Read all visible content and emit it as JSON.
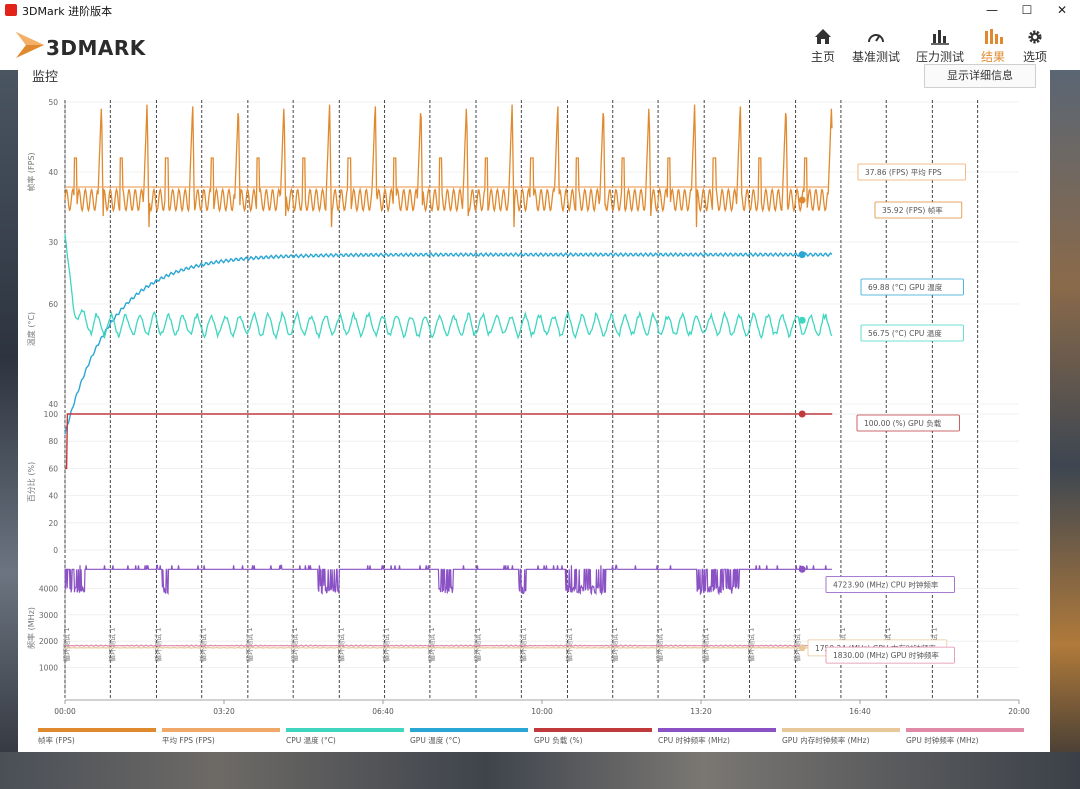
{
  "window": {
    "title": "3DMark 进阶版本",
    "minimize": "—",
    "maximize": "☐",
    "close": "✕"
  },
  "header": {
    "logo_text": "3DMARK",
    "nav": [
      {
        "label": "主页",
        "icon": "home-icon"
      },
      {
        "label": "基准测试",
        "icon": "gauge-icon"
      },
      {
        "label": "压力测试",
        "icon": "stress-chart-icon"
      },
      {
        "label": "结果",
        "icon": "results-bars-icon",
        "active": true
      },
      {
        "label": "选项",
        "icon": "gear-icon"
      }
    ]
  },
  "panel": {
    "title": "监控",
    "detail_button": "显示详细信息"
  },
  "colors": {
    "fps": "#e08a30",
    "avg_fps": "#f0a868",
    "cpu_temp": "#3fd6c0",
    "gpu_temp": "#2aa6d4",
    "gpu_load": "#c0393b",
    "cpu_clock": "#8a52c4",
    "gpu_mem_clock": "#e8c89a",
    "gpu_clock": "#e08aa8"
  },
  "chart_data": [
    {
      "type": "line",
      "ylabel": "帧率 (FPS)",
      "ylim": [
        30,
        50
      ],
      "yticks": [
        30,
        40,
        50
      ],
      "series": [
        {
          "name": "帧率 (FPS)",
          "pattern": "spiky",
          "base": 36,
          "spike": 50
        },
        {
          "name": "平均 FPS",
          "value": 37.86
        }
      ],
      "callouts": [
        {
          "text": "37.86 (FPS) 平均 FPS"
        },
        {
          "text": "35.92 (FPS) 帧率"
        }
      ]
    },
    {
      "type": "line",
      "ylabel": "温度 (°C)",
      "ylim": [
        40,
        70
      ],
      "yticks": [
        40,
        60
      ],
      "series": [
        {
          "name": "GPU 温度",
          "start": 34,
          "end": 69.88
        },
        {
          "name": "CPU 温度",
          "start": 75,
          "end": 56.75
        }
      ],
      "callouts": [
        {
          "text": "69.88 (°C) GPU 温度"
        },
        {
          "text": "56.75 (°C) CPU 温度"
        }
      ]
    },
    {
      "type": "line",
      "ylabel": "百分比 (%)",
      "ylim": [
        0,
        100
      ],
      "yticks": [
        0,
        20,
        40,
        60,
        80,
        100
      ],
      "series": [
        {
          "name": "GPU 负载",
          "start": 60,
          "end": 100
        }
      ],
      "callouts": [
        {
          "text": "100.00 (%) GPU 负载"
        }
      ]
    },
    {
      "type": "line",
      "ylabel": "频率 (MHz)",
      "ylim": [
        0,
        5000
      ],
      "yticks": [
        1000,
        2000,
        3000,
        4000
      ],
      "series": [
        {
          "name": "CPU 时钟频率",
          "value": 4723.9,
          "dip": 3800
        },
        {
          "name": "GPU 内存时钟频率",
          "value": 1750.24
        },
        {
          "name": "GPU 时钟频率",
          "value": 1830.0
        }
      ],
      "callouts": [
        {
          "text": "4723.90 (MHz) CPU 时钟频率"
        },
        {
          "text": "1750.24 (MHz) GPU 内存时钟频率"
        },
        {
          "text": "1830.00 (MHz) GPU 时钟频率"
        }
      ],
      "marker_label": "循环测试 1"
    }
  ],
  "x_axis": {
    "ticks": [
      "00:00",
      "03:20",
      "06:40",
      "10:00",
      "13:20",
      "16:40",
      "20:00"
    ],
    "max_seconds": 1200
  },
  "loop_marker_seconds": [
    0,
    57,
    115,
    172,
    230,
    287,
    345,
    402,
    459,
    517,
    574,
    632,
    689,
    746,
    804,
    861,
    919,
    976,
    1033,
    1091,
    1148
  ],
  "legend": [
    {
      "label": "帧率 (FPS)",
      "color": "#e08a30"
    },
    {
      "label": "平均 FPS (FPS)",
      "color": "#f0a868"
    },
    {
      "label": "CPU 温度 (°C)",
      "color": "#3fd6c0"
    },
    {
      "label": "GPU 温度 (°C)",
      "color": "#2aa6d4"
    },
    {
      "label": "GPU 负载 (%)",
      "color": "#c0393b"
    },
    {
      "label": "CPU 时钟频率 (MHz)",
      "color": "#8a52c4"
    },
    {
      "label": "GPU 内存时钟频率 (MHz)",
      "color": "#e8c89a"
    },
    {
      "label": "GPU 时钟频率 (MHz)",
      "color": "#e08aa8"
    }
  ]
}
